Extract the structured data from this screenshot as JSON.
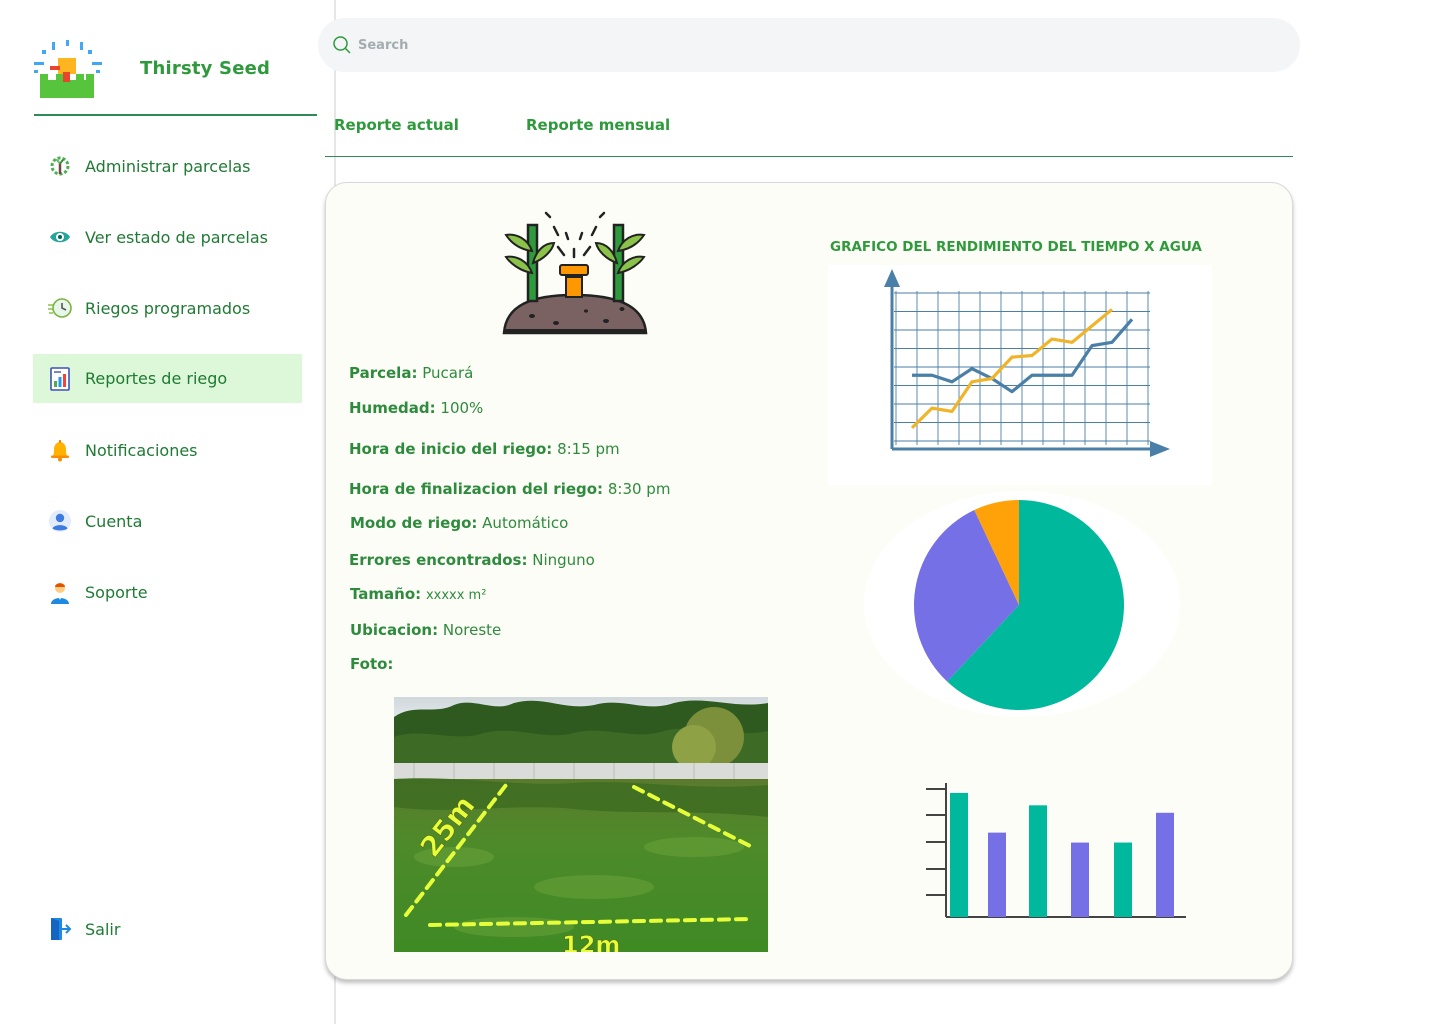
{
  "app": {
    "name": "Thirsty Seed"
  },
  "sidebar": {
    "items": [
      {
        "label": "Administrar parcelas",
        "icon": "plant-gear-icon"
      },
      {
        "label": "Ver estado de parcelas",
        "icon": "eye-icon"
      },
      {
        "label": "Riegos programados",
        "icon": "clock-icon"
      },
      {
        "label": "Reportes de riego",
        "icon": "report-chart-icon",
        "active": true
      },
      {
        "label": "Notificaciones",
        "icon": "bell-icon"
      },
      {
        "label": "Cuenta",
        "icon": "user-icon"
      },
      {
        "label": "Soporte",
        "icon": "support-agent-icon"
      }
    ],
    "logout": {
      "label": "Salir",
      "icon": "logout-icon"
    }
  },
  "search": {
    "placeholder": "Search"
  },
  "tabs": [
    {
      "label": "Reporte actual"
    },
    {
      "label": "Reporte mensual"
    }
  ],
  "report": {
    "fields": [
      {
        "label": "Parcela:",
        "value": "Pucará"
      },
      {
        "label": "Humedad:",
        "value": "100%"
      },
      {
        "label": "Hora de inicio del riego:",
        "value": "8:15 pm"
      },
      {
        "label": "Hora de finalizacion del riego:",
        "value": "8:30 pm"
      },
      {
        "label": "Modo de riego:",
        "value": "Automático"
      },
      {
        "label": "Errores encontrados:",
        "value": "Ninguno"
      },
      {
        "label": "Tamaño:",
        "value": "xxxxx m²"
      },
      {
        "label": "Ubicacion:",
        "value": "Noreste"
      },
      {
        "label": "Foto:",
        "value": ""
      }
    ],
    "photo_labels": {
      "side": "25m",
      "bottom": "12m"
    }
  },
  "colors": {
    "brand_green": "#2e9a3c",
    "active_bg": "#dcf8d8",
    "line_blue": "#4a7fa7",
    "line_yellow": "#f0b429",
    "teal": "#00b89c",
    "purple": "#7570e6",
    "orange": "#ffa20a"
  },
  "chart_data": [
    {
      "type": "line",
      "title": "GRAFICO DEL RENDIMIENTO DEL TIEMPO X AGUA",
      "x": [
        1,
        2,
        3,
        4,
        5,
        6,
        7,
        8,
        9,
        10,
        11,
        12
      ],
      "series": [
        {
          "values": [
            2.0,
            2.0,
            1.6,
            2.4,
            1.8,
            1.0,
            2.0,
            2.0,
            2.0,
            3.8,
            4.0,
            5.4
          ],
          "color": "#4a7fa7"
        },
        {
          "values": [
            -1.2,
            0.0,
            -0.2,
            1.6,
            1.8,
            3.1,
            3.2,
            4.2,
            4.0,
            5.0,
            6.0
          ],
          "color": "#f0b429"
        }
      ],
      "grid": true
    },
    {
      "type": "pie",
      "values": [
        62,
        31,
        7
      ],
      "colors": [
        "#00b89c",
        "#7570e6",
        "#ffa20a"
      ]
    },
    {
      "type": "bar",
      "values": [
        5.0,
        3.4,
        4.5,
        3.0,
        3.0,
        4.2
      ],
      "colors": [
        "#00b89c",
        "#7570e6",
        "#00b89c",
        "#7570e6",
        "#00b89c",
        "#7570e6"
      ],
      "ylim": [
        0,
        5.4
      ]
    }
  ]
}
